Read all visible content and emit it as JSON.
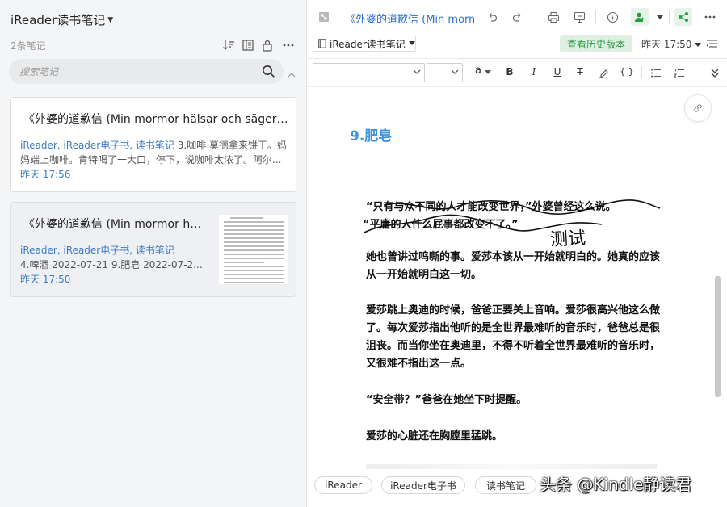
{
  "sidebar": {
    "notebook_title": "iReader读书笔记",
    "note_count": "2条笔记",
    "search": {
      "placeholder": "搜索笔记"
    },
    "notes": [
      {
        "title": "《外婆的道歉信 (Min mormor hälsar och säger f...",
        "tags": "iReader, iReader电子书, 读书笔记",
        "snippet_inline": "3.咖啡 莫德拿来饼干。妈",
        "snippet_line2": "妈端上咖啡。肯特喝了一大口，停下，说咖啡太浓了。阿尔...",
        "time": "昨天 17:56"
      },
      {
        "title": "《外婆的道歉信 (Min mormor hä...",
        "tags": "iReader, iReader电子书, 读书笔记",
        "snippet": "4.啤酒 2022-07-21 9.肥皂 2022-07-2...",
        "time": "昨天 17:50"
      }
    ]
  },
  "editor": {
    "note_title": "《外婆的道歉信 (Min mormo",
    "notebook_select": "iReader读书笔记",
    "history_button": "查看历史版本",
    "modified_time": "昨天 17:50",
    "format_font_size_label": "a",
    "format_buttons": [
      "B",
      "I",
      "U",
      "T",
      "{ }"
    ],
    "heading": "9.肥皂",
    "quote_line1": "“只有与众不同的人才能改变世界，”外婆曾经这么说。",
    "quote_line2": "“平庸的人什么屁事都改变不了。”",
    "handwriting": "测试",
    "paragraphs": [
      "她也曾讲过呜嘶的事。爱莎本该从一开始就明白的。她真的应该从一开始就明白这一切。",
      "爱莎跳上奥迪的时候，爸爸正要关上音响。爱莎很高兴他这么做了。每次爱莎指出他听的是全世界最难听的音乐时，爸爸总是很沮丧。而当你坐在奥迪里，不得不听着全世界最难听的音乐时，又很难不指出这一点。",
      "“安全带？”爸爸在她坐下时提醒。",
      "爱莎的心脏还在胸膛里猛跳。"
    ],
    "tags": [
      "iReader",
      "iReader电子书",
      "读书笔记"
    ],
    "watermark": "头条 @Kindle静读君"
  },
  "colors": {
    "accent_blue": "#3b7bc8",
    "heading_blue": "#3e93df",
    "green": "#2c9a45"
  }
}
